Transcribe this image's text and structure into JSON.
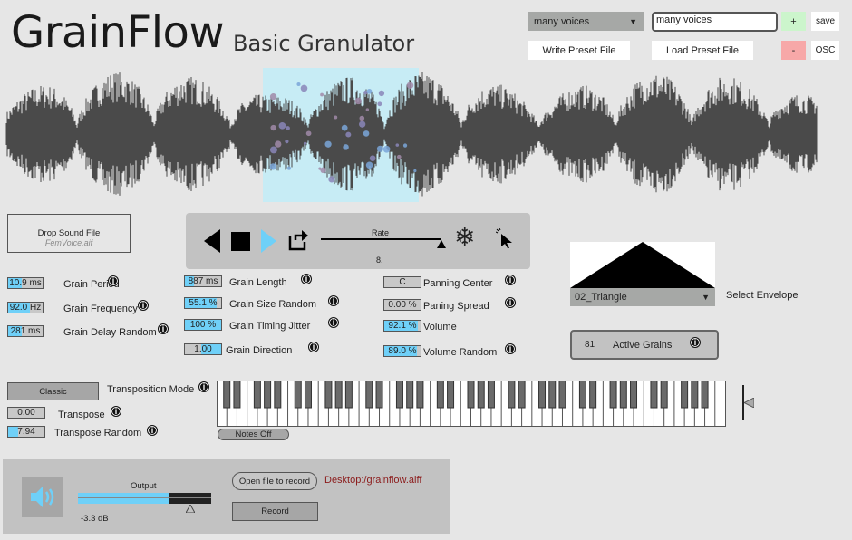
{
  "header": {
    "title": "GrainFlow",
    "subtitle": "Basic Granulator"
  },
  "presets": {
    "selected": "many voices",
    "name_input": "many voices",
    "add_label": "+",
    "remove_label": "-",
    "save_label": "save",
    "osc_label": "OSC",
    "write_label": "Write Preset File",
    "load_label": "Load Preset File"
  },
  "colors": {
    "accent": "#6fd0f8",
    "selection": "#c7ecf5",
    "record_path": "#8b1a1a",
    "add": "#ccf5cc",
    "remove": "#f7a8a8"
  },
  "sound": {
    "drop_label": "Drop Sound File",
    "file": "FemVoice.aif"
  },
  "transport": {
    "rate_label": "Rate",
    "rate_value": "8.",
    "icons": [
      "play-reverse-icon",
      "stop-icon",
      "play-icon",
      "loop-icon",
      "freeze-icon",
      "cursor-icon"
    ]
  },
  "params": [
    {
      "value": "10.9 ms",
      "label": "Grain Period",
      "fill": 0.39
    },
    {
      "value": "92.0 Hz",
      "label": "Grain Frequency",
      "fill": 0.62
    },
    {
      "value": "281 ms",
      "label": "Grain Delay Random",
      "fill": 0.39
    },
    {
      "value": "887 ms",
      "label": "Grain Length",
      "fill": 0.26
    },
    {
      "value": "55.1 %",
      "label": "Grain Size Random",
      "fill": 0.88
    },
    {
      "value": "100 %",
      "label": "Grain Timing Jitter",
      "fill": 1.0
    },
    {
      "value": "1.00",
      "label": "Grain Direction",
      "fill": 0.45
    },
    {
      "value": "C",
      "label": "Panning Center",
      "fill": 0
    },
    {
      "value": "0.00 %",
      "label": "Paning Spread",
      "fill": 0
    },
    {
      "value": "92.1 %",
      "label": "Volume",
      "fill": 0.92
    },
    {
      "value": "89.0 %",
      "label": "Volume Random",
      "fill": 0.89
    }
  ],
  "envelope": {
    "selected": "02_Triangle",
    "label": "Select Envelope"
  },
  "active_grains": {
    "count": "81",
    "label": "Active Grains"
  },
  "transposition": {
    "mode": "Classic",
    "mode_label": "Transposition Mode",
    "transpose_value": "0.00",
    "transpose_label": "Transpose",
    "random_value": "7.94",
    "random_label": "Transpose Random",
    "random_fill": 0.28
  },
  "keyboard": {
    "notes_off_label": "Notes Off"
  },
  "output": {
    "label": "Output",
    "db": "-3.3 dB",
    "level": 0.68,
    "open_label": "Open file to record",
    "record_path": "Desktop:/grainflow.aiff",
    "record_label": "Record"
  }
}
